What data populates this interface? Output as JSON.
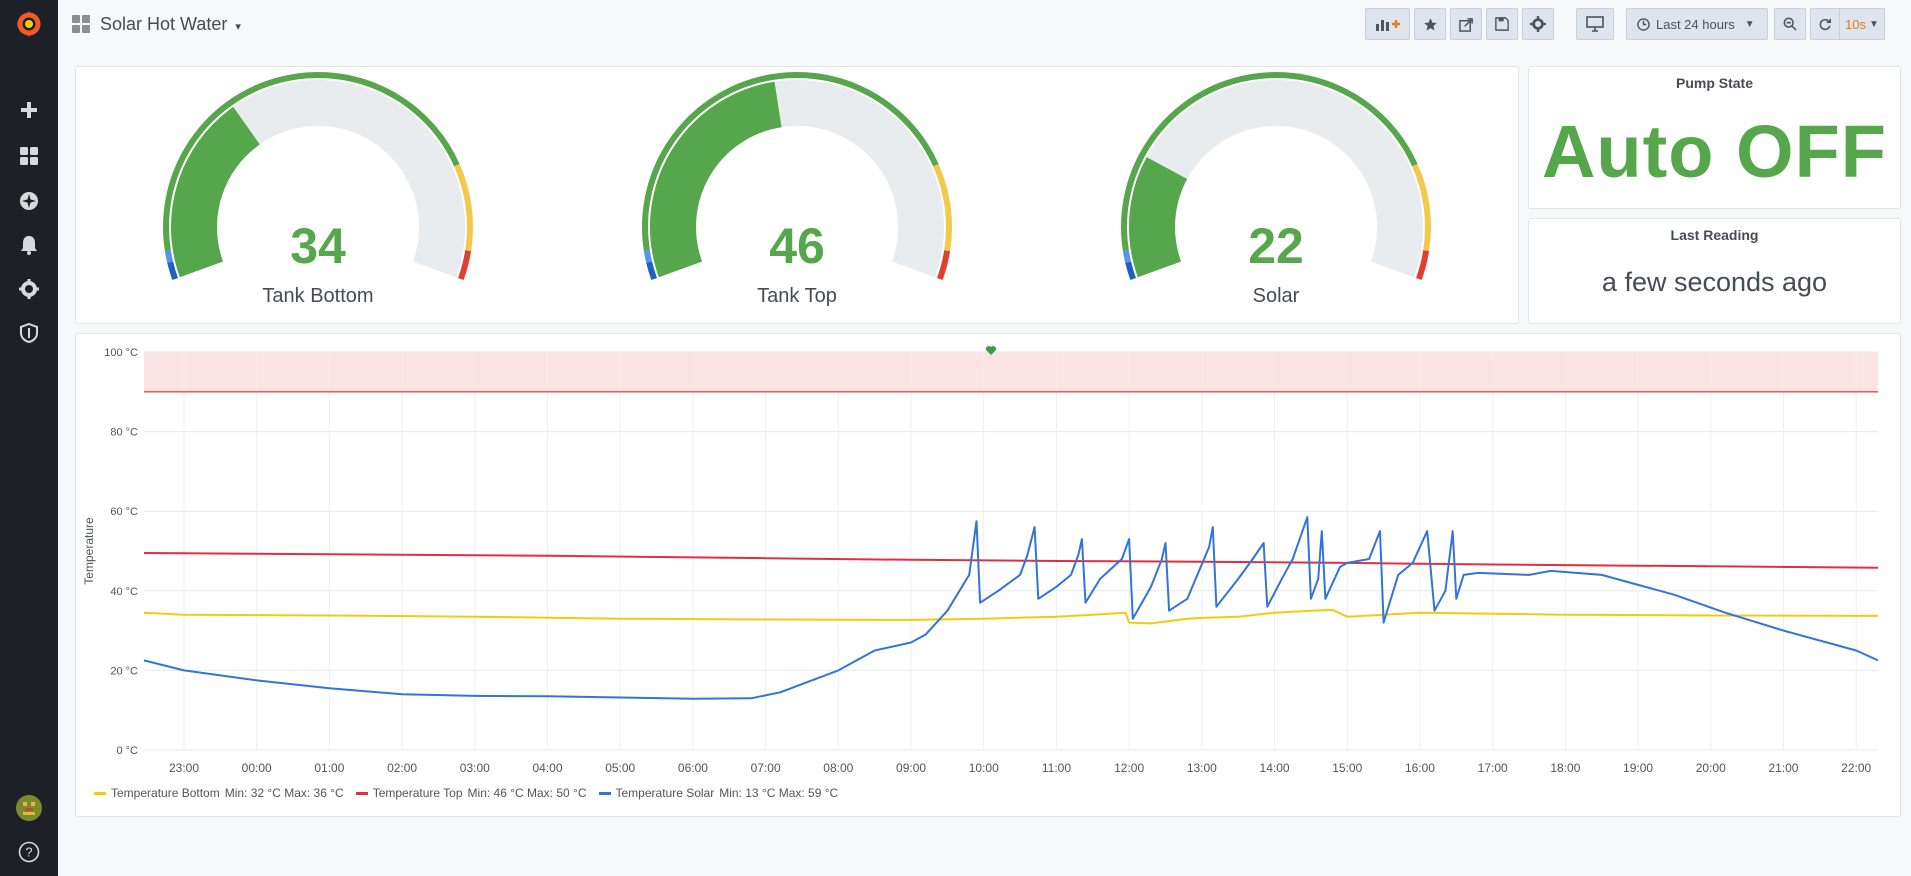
{
  "dashboard": {
    "title": "Solar Hot Water"
  },
  "toolbar": {
    "time_range": "Last 24 hours",
    "refresh_interval": "10s"
  },
  "gauges": [
    {
      "label": "Tank Bottom",
      "value": 34,
      "fill_fraction": 0.34
    },
    {
      "label": "Tank Top",
      "value": 46,
      "fill_fraction": 0.46
    },
    {
      "label": "Solar",
      "value": 22,
      "fill_fraction": 0.22
    }
  ],
  "pump_state": {
    "title": "Pump State",
    "value": "Auto OFF"
  },
  "last_reading": {
    "title": "Last Reading",
    "value": "a few seconds ago"
  },
  "colors": {
    "ok": "#56a64b",
    "warn": "#f2c94c",
    "crit": "#e0412f",
    "series_bottom": "#f2cc0c",
    "series_top": "#e02f44",
    "series_solar": "#3274d9"
  },
  "chart_data": {
    "type": "line",
    "ylabel": "Temperature",
    "ylim": [
      0,
      100
    ],
    "y_ticks": [
      "0 °C",
      "20 °C",
      "40 °C",
      "60 °C",
      "80 °C",
      "100 °C"
    ],
    "threshold": 90,
    "x_ticks": [
      "23:00",
      "00:00",
      "01:00",
      "02:00",
      "03:00",
      "04:00",
      "05:00",
      "06:00",
      "07:00",
      "08:00",
      "09:00",
      "10:00",
      "11:00",
      "12:00",
      "13:00",
      "14:00",
      "15:00",
      "16:00",
      "17:00",
      "18:00",
      "19:00",
      "20:00",
      "21:00",
      "22:00"
    ],
    "x_range_hours": [
      -0.55,
      23.3
    ],
    "series": [
      {
        "name": "Temperature Bottom",
        "legend": "Min: 32 °C  Max: 36 °C",
        "color": "#f2cc0c",
        "points": [
          [
            -0.55,
            34.5
          ],
          [
            0,
            34
          ],
          [
            2,
            33.8
          ],
          [
            4,
            33.5
          ],
          [
            6,
            33
          ],
          [
            8,
            32.8
          ],
          [
            10,
            32.7
          ],
          [
            11,
            33
          ],
          [
            12,
            33.5
          ],
          [
            12.5,
            34
          ],
          [
            12.95,
            34.5
          ],
          [
            13,
            32
          ],
          [
            13.3,
            31.8
          ],
          [
            13.8,
            33
          ],
          [
            14,
            33.2
          ],
          [
            14.5,
            33.5
          ],
          [
            15,
            34.5
          ],
          [
            15.5,
            35
          ],
          [
            15.8,
            35.2
          ],
          [
            16,
            33.5
          ],
          [
            16.5,
            34
          ],
          [
            17,
            34.5
          ],
          [
            19,
            34
          ],
          [
            21,
            33.8
          ],
          [
            23.3,
            33.7
          ]
        ]
      },
      {
        "name": "Temperature Top",
        "legend": "Min: 46 °C  Max: 50 °C",
        "color": "#e02f44",
        "points": [
          [
            -0.55,
            49.5
          ],
          [
            2,
            49.2
          ],
          [
            5,
            48.8
          ],
          [
            8,
            48.2
          ],
          [
            10,
            47.8
          ],
          [
            12,
            47.5
          ],
          [
            14,
            47.3
          ],
          [
            16,
            47
          ],
          [
            18,
            46.6
          ],
          [
            20,
            46.3
          ],
          [
            23.3,
            45.8
          ]
        ]
      },
      {
        "name": "Temperature Solar",
        "legend": "Min: 13 °C  Max: 59 °C",
        "color": "#3274d9",
        "points": [
          [
            -0.55,
            22.5
          ],
          [
            0,
            20
          ],
          [
            1,
            17.5
          ],
          [
            2,
            15.5
          ],
          [
            3,
            14
          ],
          [
            4,
            13.6
          ],
          [
            5,
            13.5
          ],
          [
            6,
            13.2
          ],
          [
            7,
            12.9
          ],
          [
            7.8,
            13
          ],
          [
            8.2,
            14.5
          ],
          [
            9,
            20
          ],
          [
            9.5,
            25
          ],
          [
            10,
            27
          ],
          [
            10.2,
            29
          ],
          [
            10.5,
            35
          ],
          [
            10.8,
            44
          ],
          [
            10.9,
            57.5
          ],
          [
            10.95,
            37
          ],
          [
            11.2,
            40
          ],
          [
            11.5,
            44
          ],
          [
            11.6,
            49
          ],
          [
            11.7,
            56
          ],
          [
            11.75,
            38
          ],
          [
            12,
            41
          ],
          [
            12.2,
            44
          ],
          [
            12.3,
            49
          ],
          [
            12.35,
            53
          ],
          [
            12.4,
            37
          ],
          [
            12.6,
            43
          ],
          [
            12.9,
            48
          ],
          [
            13,
            53
          ],
          [
            13.05,
            33
          ],
          [
            13.3,
            41
          ],
          [
            13.45,
            48
          ],
          [
            13.5,
            52
          ],
          [
            13.55,
            35
          ],
          [
            13.8,
            38
          ],
          [
            14.1,
            51
          ],
          [
            14.15,
            56
          ],
          [
            14.2,
            36
          ],
          [
            14.5,
            43
          ],
          [
            14.7,
            48
          ],
          [
            14.85,
            52
          ],
          [
            14.9,
            36
          ],
          [
            15.1,
            43
          ],
          [
            15.25,
            48
          ],
          [
            15.45,
            58.5
          ],
          [
            15.5,
            38
          ],
          [
            15.6,
            43
          ],
          [
            15.65,
            55
          ],
          [
            15.7,
            38
          ],
          [
            15.9,
            46
          ],
          [
            16,
            47
          ],
          [
            16.3,
            48
          ],
          [
            16.45,
            55
          ],
          [
            16.5,
            32
          ],
          [
            16.7,
            44
          ],
          [
            16.9,
            47
          ],
          [
            17.1,
            55
          ],
          [
            17.2,
            35
          ],
          [
            17.35,
            40
          ],
          [
            17.45,
            55
          ],
          [
            17.5,
            38
          ],
          [
            17.6,
            44
          ],
          [
            17.8,
            44.5
          ],
          [
            18.5,
            44
          ],
          [
            18.8,
            45
          ],
          [
            19.5,
            44
          ],
          [
            20.5,
            39
          ],
          [
            21.2,
            34.5
          ],
          [
            22,
            30
          ],
          [
            23,
            25
          ],
          [
            23.3,
            22.5
          ]
        ]
      }
    ]
  }
}
